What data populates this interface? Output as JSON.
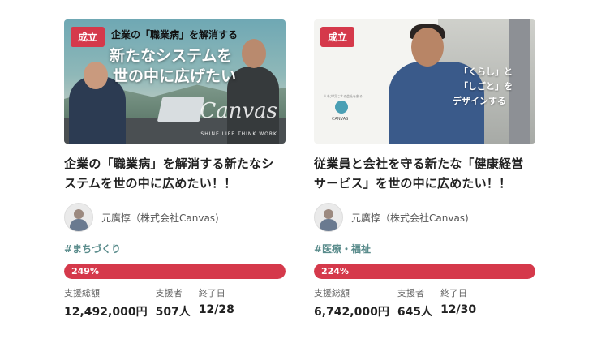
{
  "projects": [
    {
      "badge": "成立",
      "thumb": {
        "line1": "企業の「職業病」を解消する",
        "line2": "新たなシステムを",
        "line3": "世の中に広げたい",
        "logo": "Canvas",
        "sub": "SHINE LIFE  THINK WORK"
      },
      "title": "企業の「職業病」を解消する新たなシステムを世の中に広めたい！！",
      "owner": "元廣惇（株式会社Canvas)",
      "tag": "#まちづくり",
      "progress": {
        "label": "249%",
        "fraction": 1.0
      },
      "stats": [
        {
          "label": "支援総額",
          "value": "12,492,000円"
        },
        {
          "label": "支援者",
          "value": "507人"
        },
        {
          "label": "終了日",
          "value": "12/28"
        }
      ]
    },
    {
      "badge": "成立",
      "thumb": {
        "ov1": "「くらし」と",
        "ov2": "「しごと」を",
        "ov3": "デザインする",
        "logo_text": "CANVAS",
        "logo_top": "人を大切にする会社を創る"
      },
      "title": "従業員と会社を守る新たな「健康経営サービス」を世の中に広めたい！！",
      "owner": "元廣惇（株式会社Canvas)",
      "tag": "#医療・福祉",
      "progress": {
        "label": "224%",
        "fraction": 1.0
      },
      "stats": [
        {
          "label": "支援総額",
          "value": "6,742,000円"
        },
        {
          "label": "支援者",
          "value": "645人"
        },
        {
          "label": "終了日",
          "value": "12/30"
        }
      ]
    }
  ],
  "colors": {
    "accent": "#d5394b",
    "tag": "#5a8c8c"
  }
}
